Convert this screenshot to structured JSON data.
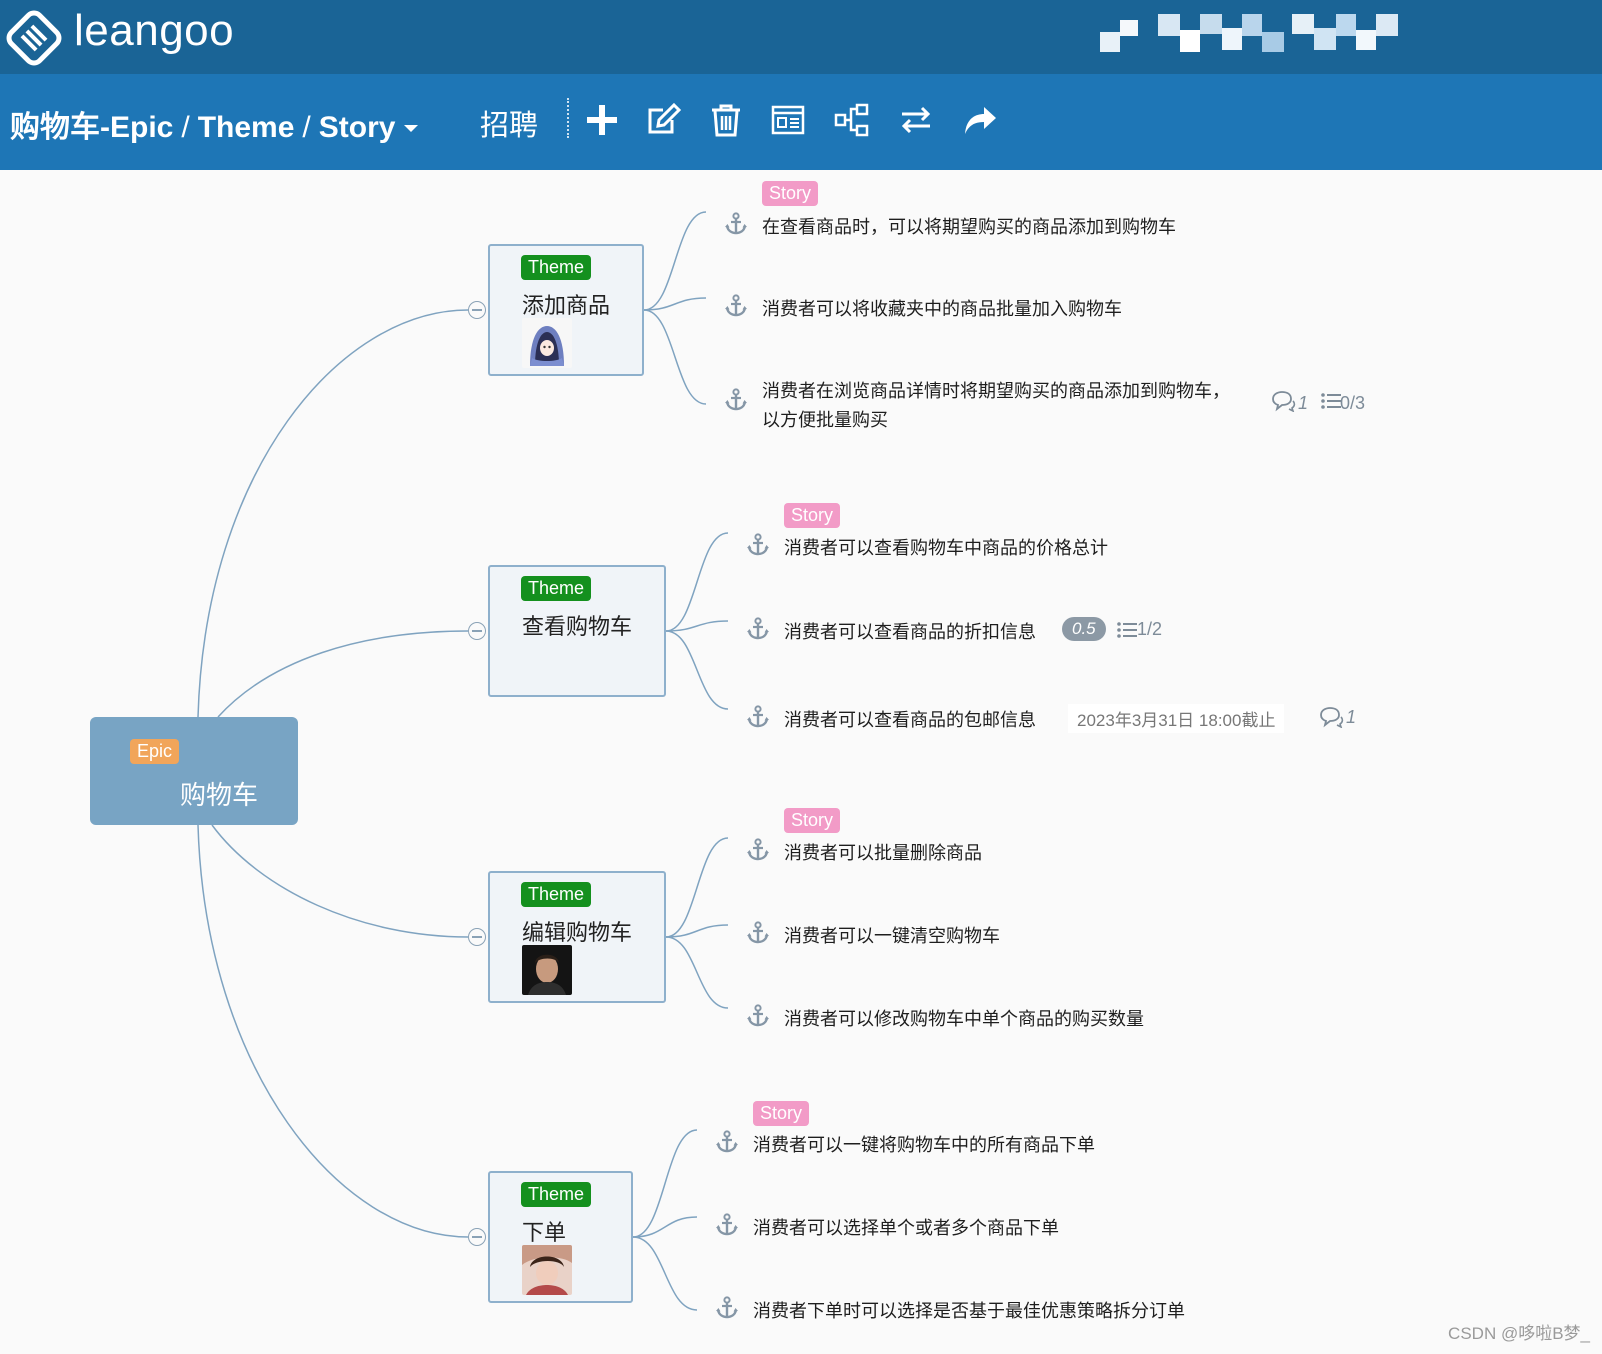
{
  "app": {
    "brand": "leangoo"
  },
  "toolbar": {
    "crumb_epic": "购物车-Epic",
    "crumb_theme": "Theme",
    "crumb_story": "Story",
    "crumb_sep": "/",
    "recruit": "招聘",
    "tools": [
      "add-icon",
      "edit-icon",
      "trash-icon",
      "card-view-icon",
      "tree-structure-icon",
      "swap-icon",
      "share-icon"
    ]
  },
  "epic": {
    "badge": "Epic",
    "title": "购物车",
    "color": "#78a4c4",
    "badge_color": "#f1a55a"
  },
  "themes": [
    {
      "badge": "Theme",
      "title": "添加商品",
      "avatar": "cartoon-girl-avatar",
      "story_badge": "Story",
      "stories": [
        {
          "text": "在查看商品时，可以将期望购买的商品添加到购物车"
        },
        {
          "text": "消费者可以将收藏夹中的商品批量加入购物车"
        },
        {
          "text": "消费者在浏览商品详情时将期望购买的商品添加到购物车，",
          "text2": "以方便批量购买",
          "comments": "1",
          "checklist": "0/3"
        }
      ]
    },
    {
      "badge": "Theme",
      "title": "查看购物车",
      "avatar": "",
      "story_badge": "Story",
      "stories": [
        {
          "text": "消费者可以查看购物车中商品的价格总计"
        },
        {
          "text": "消费者可以查看商品的折扣信息",
          "estimate": "0.5",
          "checklist": "1/2"
        },
        {
          "text": "消费者可以查看商品的包邮信息",
          "deadline": "2023年3月31日 18:00截止",
          "comments": "1"
        }
      ]
    },
    {
      "badge": "Theme",
      "title": "编辑购物车",
      "avatar": "man-portrait-avatar",
      "story_badge": "Story",
      "stories": [
        {
          "text": "消费者可以批量删除商品"
        },
        {
          "text": "消费者可以一键清空购物车"
        },
        {
          "text": "消费者可以修改购物车中单个商品的购买数量"
        }
      ]
    },
    {
      "badge": "Theme",
      "title": "下单",
      "avatar": "woman-portrait-avatar",
      "story_badge": "Story",
      "stories": [
        {
          "text": "消费者可以一键将购物车中的所有商品下单"
        },
        {
          "text": "消费者可以选择单个或者多个商品下单"
        },
        {
          "text": "消费者下单时可以选择是否基于最佳优惠策略拆分订单"
        }
      ]
    }
  ],
  "colors": {
    "header": "#1a6496",
    "toolbar": "#1e76b6",
    "theme_badge": "#14901e",
    "story_badge": "#f29bc7",
    "connector": "#7fa3c0"
  },
  "watermark": "CSDN @哆啦B梦_"
}
